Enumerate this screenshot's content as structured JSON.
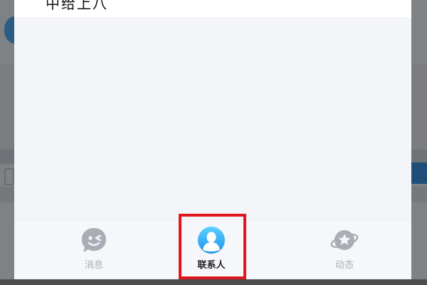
{
  "header": {
    "title": "中给上八"
  },
  "tabbar": {
    "tabs": [
      {
        "label": "消息",
        "icon": "message-bubble-icon",
        "active": false
      },
      {
        "label": "联系人",
        "icon": "contacts-person-icon",
        "active": true
      },
      {
        "label": "动态",
        "icon": "planet-star-icon",
        "active": false
      }
    ]
  },
  "colors": {
    "accent": "#2ba4f2",
    "highlight": "#e3141a",
    "inactive": "#a9adb6"
  }
}
